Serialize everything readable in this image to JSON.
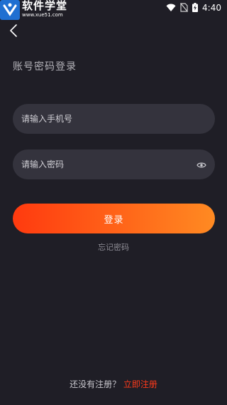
{
  "watermark": {
    "title": "软件学堂",
    "url": "www.xue51.com"
  },
  "status_bar": {
    "time": "4:40",
    "icons": [
      "wifi-icon",
      "no-sim-icon",
      "battery-charging-icon"
    ]
  },
  "header": {
    "back_icon": "chevron-left-icon"
  },
  "page": {
    "title": "账号密码登录"
  },
  "form": {
    "phone_placeholder": "请输入手机号",
    "phone_value": "",
    "password_placeholder": "请输入密码",
    "password_value": "",
    "password_toggle_icon": "eye-icon",
    "login_label": "登录",
    "forgot_label": "忘记密码"
  },
  "footer": {
    "prompt": "还没有注册？",
    "register_label": "立即注册"
  },
  "colors": {
    "background": "#1f1e26",
    "input_background": "#34333d",
    "button_gradient_start": "#ff3a0f",
    "button_gradient_end": "#ff8a22",
    "register_link": "#ff3a1a"
  }
}
